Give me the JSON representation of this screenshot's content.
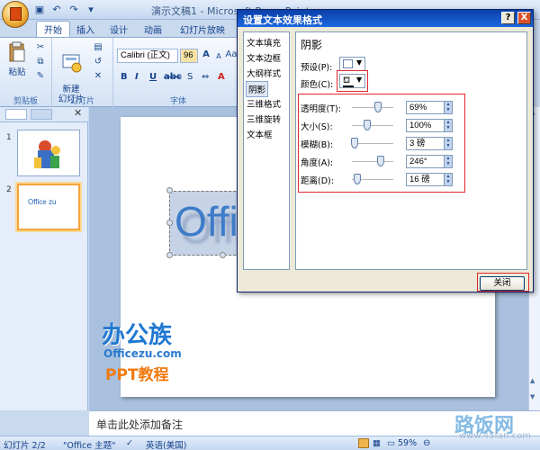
{
  "window": {
    "title": "演示文稿1 - Microsoft PowerPoint"
  },
  "ribbon": {
    "tabs": [
      "开始",
      "插入",
      "设计",
      "动画",
      "幻灯片放映"
    ],
    "active_tab": "开始",
    "clipboard": {
      "paste_label": "粘贴",
      "group_label": "剪贴板"
    },
    "slides": {
      "new_slide_label": "新建\n幻灯片",
      "group_label": "幻灯片"
    },
    "font": {
      "font_name": "Calibri (正文)",
      "font_size": "96",
      "group_label": "字体",
      "grow_label": "A",
      "shrink_label": "A",
      "aa_label": "Aa"
    }
  },
  "slides_panel": {
    "thumbnails": [
      {
        "number": "1"
      },
      {
        "number": "2",
        "text": "Office zu"
      }
    ]
  },
  "slide": {
    "textbox_text": "Office zu"
  },
  "notes": {
    "placeholder": "单击此处添加备注"
  },
  "statusbar": {
    "slide_info": "幻灯片 2/2",
    "theme": "\"Office 主题\"",
    "language": "英语(美国)",
    "zoom": "59%"
  },
  "watermarks": {
    "logo": "办公族",
    "url": "Officezu.com",
    "ppt": "PPT教程",
    "lufan": "路饭网",
    "site": "www.45fan.com"
  },
  "dialog": {
    "title": "设置文本效果格式",
    "help_label": "?",
    "close_x_label": "X",
    "nav": [
      "文本填充",
      "文本边框",
      "大纲样式",
      "阴影",
      "三维格式",
      "三维旋转",
      "文本框"
    ],
    "selected_nav": "阴影",
    "section_title": "阴影",
    "preset_label": "预设(P):",
    "color_label": "颜色(C):",
    "rows": [
      {
        "label": "透明度(T):",
        "value": "69%",
        "knob": 0.62
      },
      {
        "label": "大小(S):",
        "value": "100%",
        "knob": 0.33
      },
      {
        "label": "模糊(B):",
        "value": "3 磅",
        "knob": 0.03
      },
      {
        "label": "角度(A):",
        "value": "246°",
        "knob": 0.68
      },
      {
        "label": "距离(D):",
        "value": "16 磅",
        "knob": 0.08
      }
    ],
    "close_button": "关闭"
  }
}
